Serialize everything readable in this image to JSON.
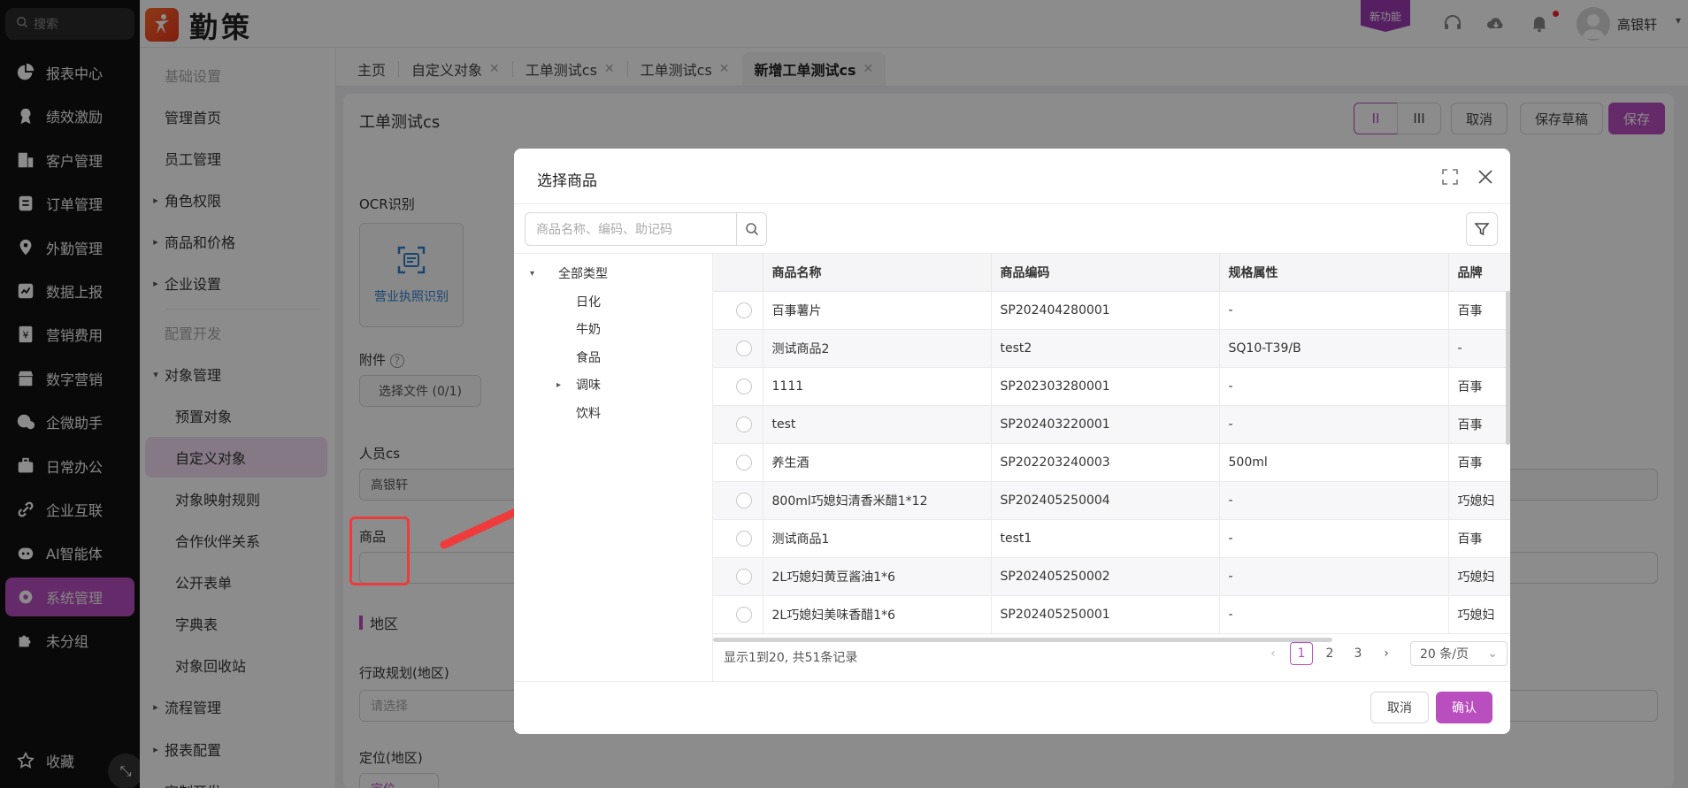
{
  "search": {
    "placeholder": "搜索"
  },
  "nav": {
    "items": [
      {
        "label": "报表中心",
        "icon": "pie-chart-icon"
      },
      {
        "label": "绩效激励",
        "icon": "medal-icon"
      },
      {
        "label": "客户管理",
        "icon": "building-icon"
      },
      {
        "label": "订单管理",
        "icon": "clipboard-icon"
      },
      {
        "label": "外勤管理",
        "icon": "location-pin-icon"
      },
      {
        "label": "数据上报",
        "icon": "chart-report-icon"
      },
      {
        "label": "营销费用",
        "icon": "expense-icon"
      },
      {
        "label": "数字营销",
        "icon": "store-icon"
      },
      {
        "label": "企微助手",
        "icon": "chat-icon"
      },
      {
        "label": "日常办公",
        "icon": "briefcase-icon"
      },
      {
        "label": "企业互联",
        "icon": "link-icon"
      },
      {
        "label": "AI智能体",
        "icon": "robot-icon"
      },
      {
        "label": "系统管理",
        "icon": "gear-icon"
      },
      {
        "label": "未分组",
        "icon": "puzzle-icon"
      }
    ],
    "favorites": "收藏"
  },
  "header": {
    "brand": "勤策",
    "new_feature": "新功能",
    "username": "高银轩"
  },
  "submenu": {
    "group1": "基础设置",
    "home": "管理首页",
    "staff": "员工管理",
    "roles": "角色权限",
    "products": "商品和价格",
    "enterprise": "企业设置",
    "group2": "配置开发",
    "objects": "对象管理",
    "preset": "预置对象",
    "custom": "自定义对象",
    "mapping": "对象映射规则",
    "partner": "合作伙伴关系",
    "public_form": "公开表单",
    "dictionary": "字典表",
    "recycle": "对象回收站",
    "flow": "流程管理",
    "report": "报表配置",
    "more": "定制开发"
  },
  "tabs": [
    {
      "label": "主页",
      "closable": false
    },
    {
      "label": "自定义对象",
      "closable": true
    },
    {
      "label": "工单测试cs",
      "closable": true
    },
    {
      "label": "工单测试cs",
      "closable": true
    },
    {
      "label": "新增工单测试cs",
      "closable": true,
      "active": true
    }
  ],
  "main": {
    "title": "工单测试cs",
    "layout_one": "II",
    "layout_two": "III",
    "cancel": "取消",
    "save_draft": "保存草稿",
    "save": "保存",
    "ocr_label": "OCR识别",
    "ocr_button": "营业执照识别",
    "attachment_label": "附件",
    "attachment_button": "选择文件 (0/1)",
    "person_label": "人员cs",
    "person_value": "高银轩",
    "product_label": "商品",
    "region_section": "地区",
    "admin_region_label": "行政规划(地区)",
    "admin_region_placeholder": "请选择",
    "location_label": "定位(地区)",
    "location_button": "定位"
  },
  "modal": {
    "title": "选择商品",
    "search_placeholder": "商品名称、编码、助记码",
    "tree": {
      "root": "全部类型",
      "children": [
        "日化",
        "牛奶",
        "食品",
        "调味",
        "饮料"
      ]
    },
    "columns": [
      "商品名称",
      "商品编码",
      "规格属性",
      "品牌"
    ],
    "rows": [
      [
        "百事薯片",
        "SP202404280001",
        "-",
        "百事"
      ],
      [
        "测试商品2",
        "test2",
        "SQ10-T39/B",
        "-"
      ],
      [
        "1111",
        "SP202303280001",
        "-",
        "百事"
      ],
      [
        "test",
        "SP202403220001",
        "-",
        "百事"
      ],
      [
        "养生酒",
        "SP202203240003",
        "500ml",
        "百事"
      ],
      [
        "800ml巧媳妇清香米醋1*12",
        "SP202405250004",
        "-",
        "巧媳妇"
      ],
      [
        "测试商品1",
        "test1",
        "-",
        "百事"
      ],
      [
        "2L巧媳妇黄豆酱油1*6",
        "SP202405250002",
        "-",
        "巧媳妇"
      ],
      [
        "2L巧媳妇美味香醋1*6",
        "SP202405250001",
        "-",
        "巧媳妇"
      ]
    ],
    "pager_text": "显示1到20, 共51条记录",
    "pages": [
      "1",
      "2",
      "3"
    ],
    "page_size": "20 条/页",
    "cancel": "取消",
    "confirm": "确认"
  },
  "colors": {
    "accent": "#b94ebf",
    "highlight": "#ef3b3b"
  }
}
